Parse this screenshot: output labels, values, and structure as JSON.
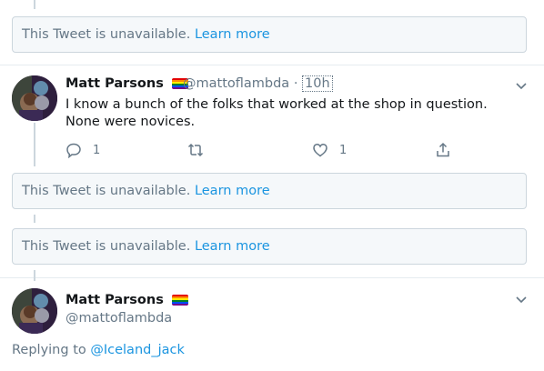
{
  "unavailable": {
    "message": "This Tweet is unavailable.",
    "learn_more": "Learn more"
  },
  "tweet": {
    "name": "Matt Parsons",
    "handle": "@mattoflambda",
    "separator": "·",
    "time": "10h",
    "text": "I know a bunch of the folks that worked at the shop in question. None were novices.",
    "reply_count": "1",
    "like_count": "1",
    "flag_icon": "rainbow-flag-icon"
  },
  "bottom_tweet": {
    "name": "Matt Parsons",
    "handle": "@mattoflambda",
    "replying_to_label": "Replying to",
    "replying_to_user": "@Iceland_jack"
  },
  "colors": {
    "link": "#1b95e0",
    "muted": "#657786",
    "border": "#ccd6dd",
    "panel": "#f5f8fa"
  }
}
